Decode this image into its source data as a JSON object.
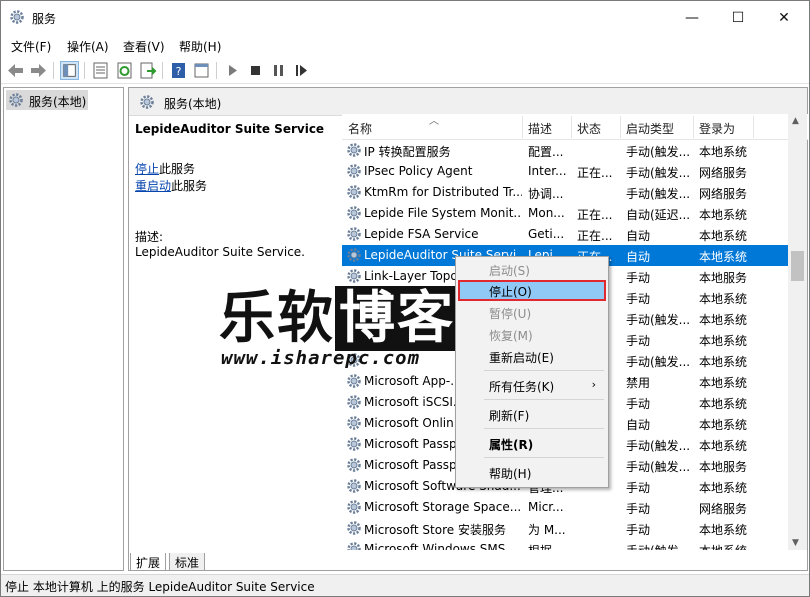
{
  "window": {
    "title": "服务",
    "minimize_glyph": "—",
    "maximize_glyph": "☐",
    "close_glyph": "✕"
  },
  "menu": [
    "文件(F)",
    "操作(A)",
    "查看(V)",
    "帮助(H)"
  ],
  "tree": {
    "item": "服务(本地)"
  },
  "pane": {
    "header": "服务(本地)",
    "service_title": "LepideAuditor Suite Service",
    "stop_link": "停止",
    "stop_suffix": "此服务",
    "restart_link": "重启动",
    "restart_suffix": "此服务",
    "desc_label": "描述:",
    "desc_text": "LepideAuditor Suite Service."
  },
  "columns": {
    "name": "名称",
    "desc": "描述",
    "status": "状态",
    "startup": "启动类型",
    "logon": "登录为"
  },
  "services": [
    {
      "name": "IP 转换配置服务",
      "desc": "配置...",
      "status": "",
      "startup": "手动(触发...",
      "logon": "本地系统"
    },
    {
      "name": "IPsec Policy Agent",
      "desc": "Inter...",
      "status": "正在...",
      "startup": "手动(触发...",
      "logon": "网络服务"
    },
    {
      "name": "KtmRm for Distributed Tr...",
      "desc": "协调...",
      "status": "",
      "startup": "手动(触发...",
      "logon": "网络服务"
    },
    {
      "name": "Lepide File System Monit...",
      "desc": "Mon...",
      "status": "正在...",
      "startup": "自动(延迟...",
      "logon": "本地系统"
    },
    {
      "name": "Lepide FSA Service",
      "desc": "Geti...",
      "status": "正在...",
      "startup": "自动",
      "logon": "本地系统"
    },
    {
      "name": "LepideAuditor Suite Servi...",
      "desc": "Lepi...",
      "status": "正在...",
      "startup": "自动",
      "logon": "本地系统"
    },
    {
      "name": "Link-Layer Topo...",
      "desc": "",
      "status": "",
      "startup": "手动",
      "logon": "本地服务"
    },
    {
      "name": "",
      "desc": "",
      "status": "",
      "startup": "手动",
      "logon": "本地系统"
    },
    {
      "name": "",
      "desc": "",
      "status": "",
      "startup": "手动(触发...",
      "logon": "本地系统"
    },
    {
      "name": "",
      "desc": "",
      "status": "",
      "startup": "手动",
      "logon": "本地系统"
    },
    {
      "name": "",
      "desc": "",
      "status": "",
      "startup": "手动(触发...",
      "logon": "本地系统"
    },
    {
      "name": "Microsoft App-...",
      "desc": "",
      "status": "",
      "startup": "禁用",
      "logon": "本地系统"
    },
    {
      "name": "Microsoft iSCSI...",
      "desc": "",
      "status": "",
      "startup": "手动",
      "logon": "本地系统"
    },
    {
      "name": "Microsoft Onlin...",
      "desc": "",
      "status": "",
      "startup": "自动",
      "logon": "本地系统"
    },
    {
      "name": "Microsoft Passp...",
      "desc": "",
      "status": "",
      "startup": "手动(触发...",
      "logon": "本地系统"
    },
    {
      "name": "Microsoft Passp...",
      "desc": "",
      "status": "",
      "startup": "手动(触发...",
      "logon": "本地服务"
    },
    {
      "name": "Microsoft Software Shad...",
      "desc": "管理...",
      "status": "",
      "startup": "手动",
      "logon": "本地系统"
    },
    {
      "name": "Microsoft Storage Space...",
      "desc": "Micr...",
      "status": "",
      "startup": "手动",
      "logon": "网络服务"
    },
    {
      "name": "Microsoft Store 安装服务",
      "desc": "为 M...",
      "status": "",
      "startup": "手动",
      "logon": "本地系统"
    },
    {
      "name": "Microsoft Windows SMS ...",
      "desc": "根据...",
      "status": "",
      "startup": "手动(触发...",
      "logon": "本地系统"
    }
  ],
  "context_menu": {
    "start": "启动(S)",
    "stop": "停止(O)",
    "pause": "暂停(U)",
    "resume": "恢复(M)",
    "restart": "重新启动(E)",
    "all_tasks": "所有任务(K)",
    "refresh": "刷新(F)",
    "properties": "属性(R)",
    "help": "帮助(H)"
  },
  "tabs": [
    "扩展",
    "标准"
  ],
  "statusbar": "停止 本地计算机 上的服务 LepideAuditor Suite Service",
  "watermark": {
    "title_a": "乐软",
    "title_b": "博客",
    "url": "www.isharepc.com"
  },
  "colors": {
    "selection": "#0078d7",
    "highlight_border": "#e0282e",
    "link": "#0645ad"
  }
}
